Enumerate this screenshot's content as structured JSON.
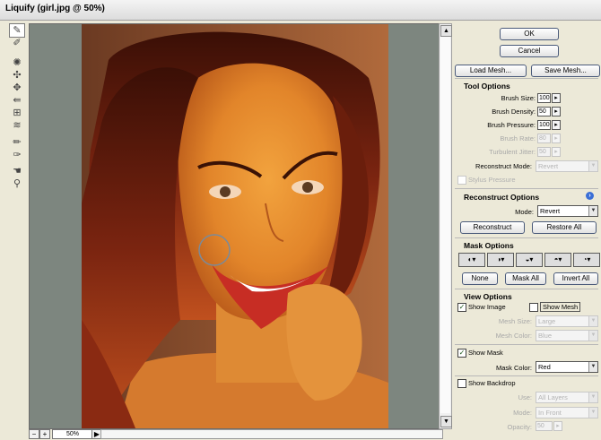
{
  "window": {
    "title": "Liquify (girl.jpg @ 50%)"
  },
  "toolbox": {
    "tools": [
      "warp-tool-icon",
      "reconstruct-tool-icon",
      "twirl-clockwise-tool-icon",
      "pucker-tool-icon",
      "bloat-tool-icon",
      "push-left-tool-icon",
      "mirror-tool-icon",
      "turbulence-tool-icon",
      "freeze-mask-tool-icon",
      "thaw-mask-tool-icon",
      "hand-tool-icon",
      "zoom-tool-icon"
    ]
  },
  "statusbar": {
    "minus": "−",
    "plus": "+",
    "zoom": "50%",
    "menu_arrow": "▶"
  },
  "buttons": {
    "ok": "OK",
    "cancel": "Cancel",
    "load_mesh": "Load Mesh...",
    "save_mesh": "Save Mesh..."
  },
  "tool_options": {
    "heading": "Tool Options",
    "brush_size_label": "Brush Size:",
    "brush_size": "100",
    "brush_density_label": "Brush Density:",
    "brush_density": "50",
    "brush_pressure_label": "Brush Pressure:",
    "brush_pressure": "100",
    "brush_rate_label": "Brush Rate:",
    "brush_rate": "80",
    "turbulent_jitter_label": "Turbulent Jitter:",
    "turbulent_jitter": "50",
    "reconstruct_mode_label": "Reconstruct Mode:",
    "reconstruct_mode": "Revert",
    "stylus_pressure": "Stylus Pressure"
  },
  "reconstruct_options": {
    "heading": "Reconstruct Options",
    "mode_label": "Mode:",
    "mode": "Revert",
    "reconstruct": "Reconstruct",
    "restore_all": "Restore All"
  },
  "mask_options": {
    "heading": "Mask Options",
    "none": "None",
    "mask_all": "Mask All",
    "invert_all": "Invert All"
  },
  "view_options": {
    "heading": "View Options",
    "show_image": "Show Image",
    "show_mesh": "Show Mesh",
    "mesh_size_label": "Mesh Size:",
    "mesh_size": "Large",
    "mesh_color_label": "Mesh Color:",
    "mesh_color": "Blue",
    "show_mask": "Show Mask",
    "mask_color_label": "Mask Color:",
    "mask_color": "Red",
    "show_backdrop": "Show Backdrop",
    "use_label": "Use:",
    "use": "All Layers",
    "mode_label": "Mode:",
    "mode": "In Front",
    "opacity_label": "Opacity:",
    "opacity": "50"
  },
  "colors": {
    "accent_border": "#4a5a7a",
    "canvas_bg": "#7d867f",
    "check_green": "#1e5a1e"
  }
}
